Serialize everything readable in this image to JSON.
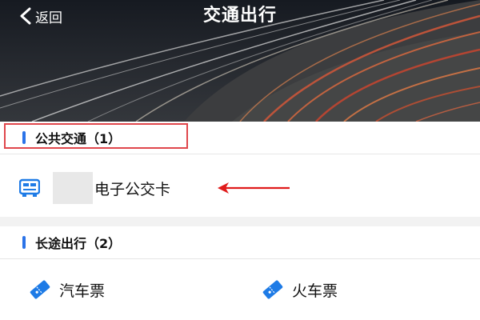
{
  "header": {
    "back_label": "返回",
    "title": "交通出行"
  },
  "sections": [
    {
      "title": "公共交通（1）",
      "items": [
        {
          "label": "电子公交卡",
          "icon": "bus-card-icon"
        }
      ]
    },
    {
      "title": "长途出行（2）",
      "items": [
        {
          "label": "汽车票",
          "icon": "ticket-icon"
        },
        {
          "label": "火车票",
          "icon": "ticket-icon"
        }
      ]
    }
  ],
  "colors": {
    "accent": "#2a73e8",
    "highlight": "#e0474c",
    "icon": "#1e7be6"
  }
}
